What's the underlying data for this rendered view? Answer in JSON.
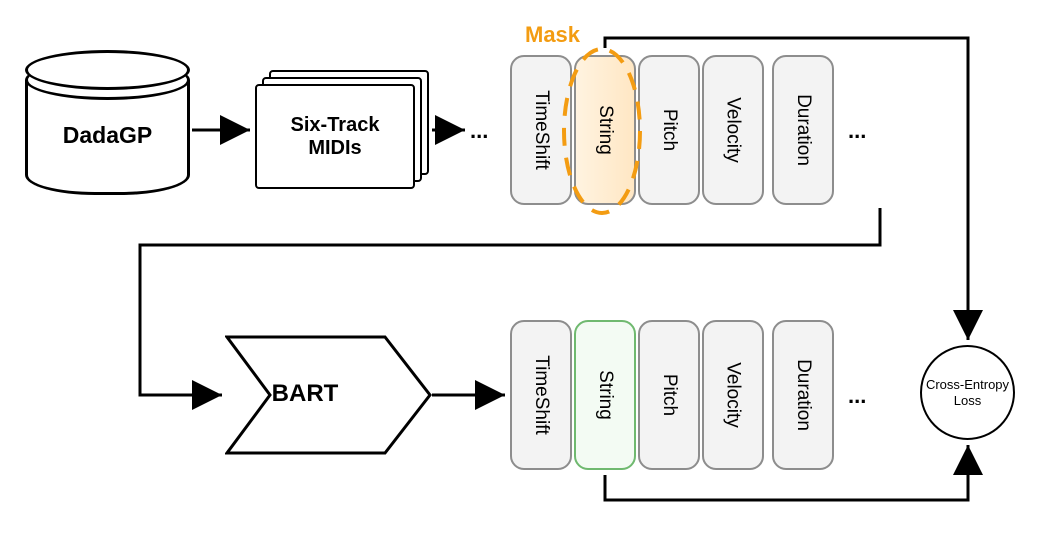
{
  "diagram": {
    "dataset_label": "DadaGP",
    "midi_box_label": "Six-Track MIDIs",
    "mask_label": "Mask",
    "model_label": "BART",
    "loss_line1": "Cross-Entropy",
    "loss_line2": "Loss",
    "ellipsis": "...",
    "tokens_top": {
      "t0": "TimeShift",
      "t1": "String",
      "t2": "Pitch",
      "t3": "Velocity",
      "t4": "Duration"
    },
    "tokens_bot": {
      "t0": "TimeShift",
      "t1": "String",
      "t2": "Pitch",
      "t3": "Velocity",
      "t4": "Duration"
    }
  }
}
